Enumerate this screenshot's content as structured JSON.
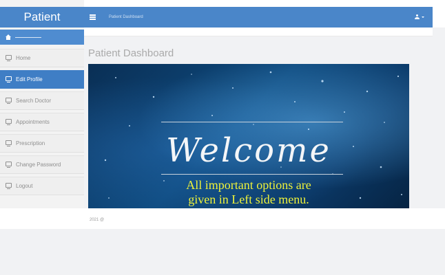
{
  "sidebar": {
    "brand": "Patient",
    "items": [
      {
        "label": "Home",
        "active": false
      },
      {
        "label": "Edit Profile",
        "active": true
      },
      {
        "label": "Search Doctor",
        "active": false
      },
      {
        "label": "Appointments",
        "active": false
      },
      {
        "label": "Prescription",
        "active": false
      },
      {
        "label": "Change Password",
        "active": false
      },
      {
        "label": "Logout",
        "active": false
      }
    ]
  },
  "topbar": {
    "breadcrumb": "Patient Dashboard"
  },
  "main": {
    "title": "Patient Dashboard",
    "banner": {
      "heading": "Welcome",
      "line1": "All important options are",
      "line2": "given in Left side menu."
    }
  },
  "footer": {
    "text": "2021 @"
  },
  "colors": {
    "primary": "#4a86c9",
    "active": "#3f7ec5",
    "accent_text": "#eef23a"
  },
  "icons": {
    "nav": "monitor-icon",
    "menu": "hamburger-icon",
    "user": "user-icon",
    "home": "home-icon"
  }
}
